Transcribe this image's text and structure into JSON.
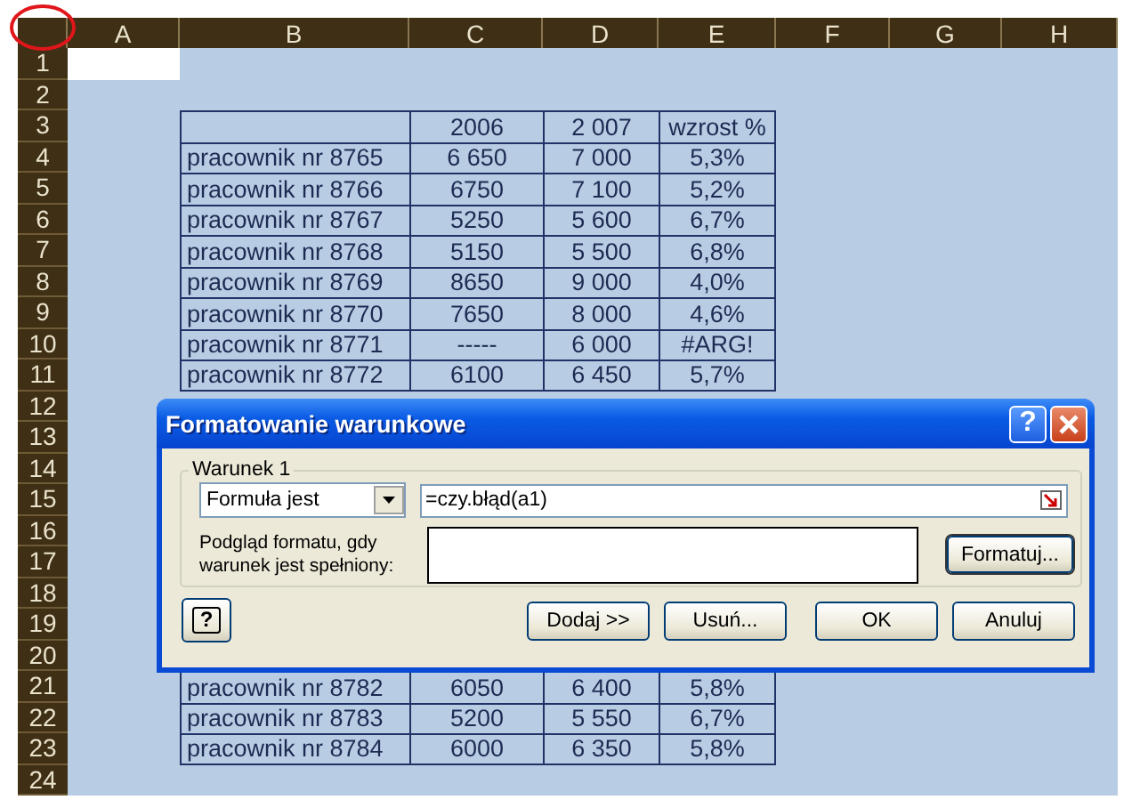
{
  "sheet": {
    "columns": [
      "A",
      "B",
      "C",
      "D",
      "E",
      "F",
      "G",
      "H"
    ],
    "rows": [
      {
        "number": "1",
        "a_selected": true
      },
      {
        "number": "2",
        "a_selected": false
      },
      {
        "number": "3",
        "a_selected": false,
        "cells": {
          "c": "2006",
          "d": "2 007",
          "e": "wzrost %"
        }
      },
      {
        "number": "4",
        "a_selected": false,
        "cells": {
          "b": "pracownik nr 8765",
          "c": "6 650",
          "d": "7 000",
          "e": "5,3%"
        }
      },
      {
        "number": "5",
        "a_selected": false,
        "cells": {
          "b": "pracownik nr 8766",
          "c": "6750",
          "d": "7 100",
          "e": "5,2%"
        }
      },
      {
        "number": "6",
        "a_selected": false,
        "cells": {
          "b": "pracownik nr 8767",
          "c": "5250",
          "d": "5 600",
          "e": "6,7%"
        }
      },
      {
        "number": "7",
        "a_selected": false,
        "cells": {
          "b": "pracownik nr 8768",
          "c": "5150",
          "d": "5 500",
          "e": "6,8%"
        }
      },
      {
        "number": "8",
        "a_selected": false,
        "cells": {
          "b": "pracownik nr 8769",
          "c": "8650",
          "d": "9 000",
          "e": "4,0%"
        }
      },
      {
        "number": "9",
        "a_selected": false,
        "cells": {
          "b": "pracownik nr 8770",
          "c": "7650",
          "d": "8 000",
          "e": "4,6%"
        }
      },
      {
        "number": "10",
        "a_selected": false,
        "cells": {
          "b": "pracownik nr 8771",
          "c": "-----",
          "d": "6 000",
          "e": "#ARG!"
        }
      },
      {
        "number": "11",
        "a_selected": false,
        "cells": {
          "b": "pracownik nr 8772",
          "c": "6100",
          "d": "6 450",
          "e": "5,7%"
        }
      },
      {
        "number": "12",
        "a_selected": false
      },
      {
        "number": "13",
        "a_selected": false
      },
      {
        "number": "14",
        "a_selected": false
      },
      {
        "number": "15",
        "a_selected": false
      },
      {
        "number": "16",
        "a_selected": false
      },
      {
        "number": "17",
        "a_selected": false
      },
      {
        "number": "18",
        "a_selected": false
      },
      {
        "number": "19",
        "a_selected": false
      },
      {
        "number": "20",
        "a_selected": false
      },
      {
        "number": "21",
        "a_selected": false,
        "cells": {
          "b": "pracownik nr 8782",
          "c": "6050",
          "d": "6 400",
          "e": "5,8%"
        }
      },
      {
        "number": "22",
        "a_selected": false,
        "cells": {
          "b": "pracownik nr 8783",
          "c": "5200",
          "d": "5 550",
          "e": "6,7%"
        }
      },
      {
        "number": "23",
        "a_selected": false,
        "cells": {
          "b": "pracownik nr 8784",
          "c": "6000",
          "d": "6 350",
          "e": "5,8%"
        }
      },
      {
        "number": "24",
        "a_selected": false
      }
    ]
  },
  "dialog": {
    "title": "Formatowanie warunkowe",
    "help_button": "?",
    "group_label": "Warunek 1",
    "condition_type": "Formuła jest",
    "formula": "=czy.błąd(a1)",
    "preview_label": "Podgląd formatu, gdy warunek jest spełniony:",
    "format_button": "Formatuj...",
    "assistant_button": "?",
    "buttons": [
      "Dodaj >>",
      "Usuń...",
      "OK",
      "Anuluj"
    ]
  }
}
